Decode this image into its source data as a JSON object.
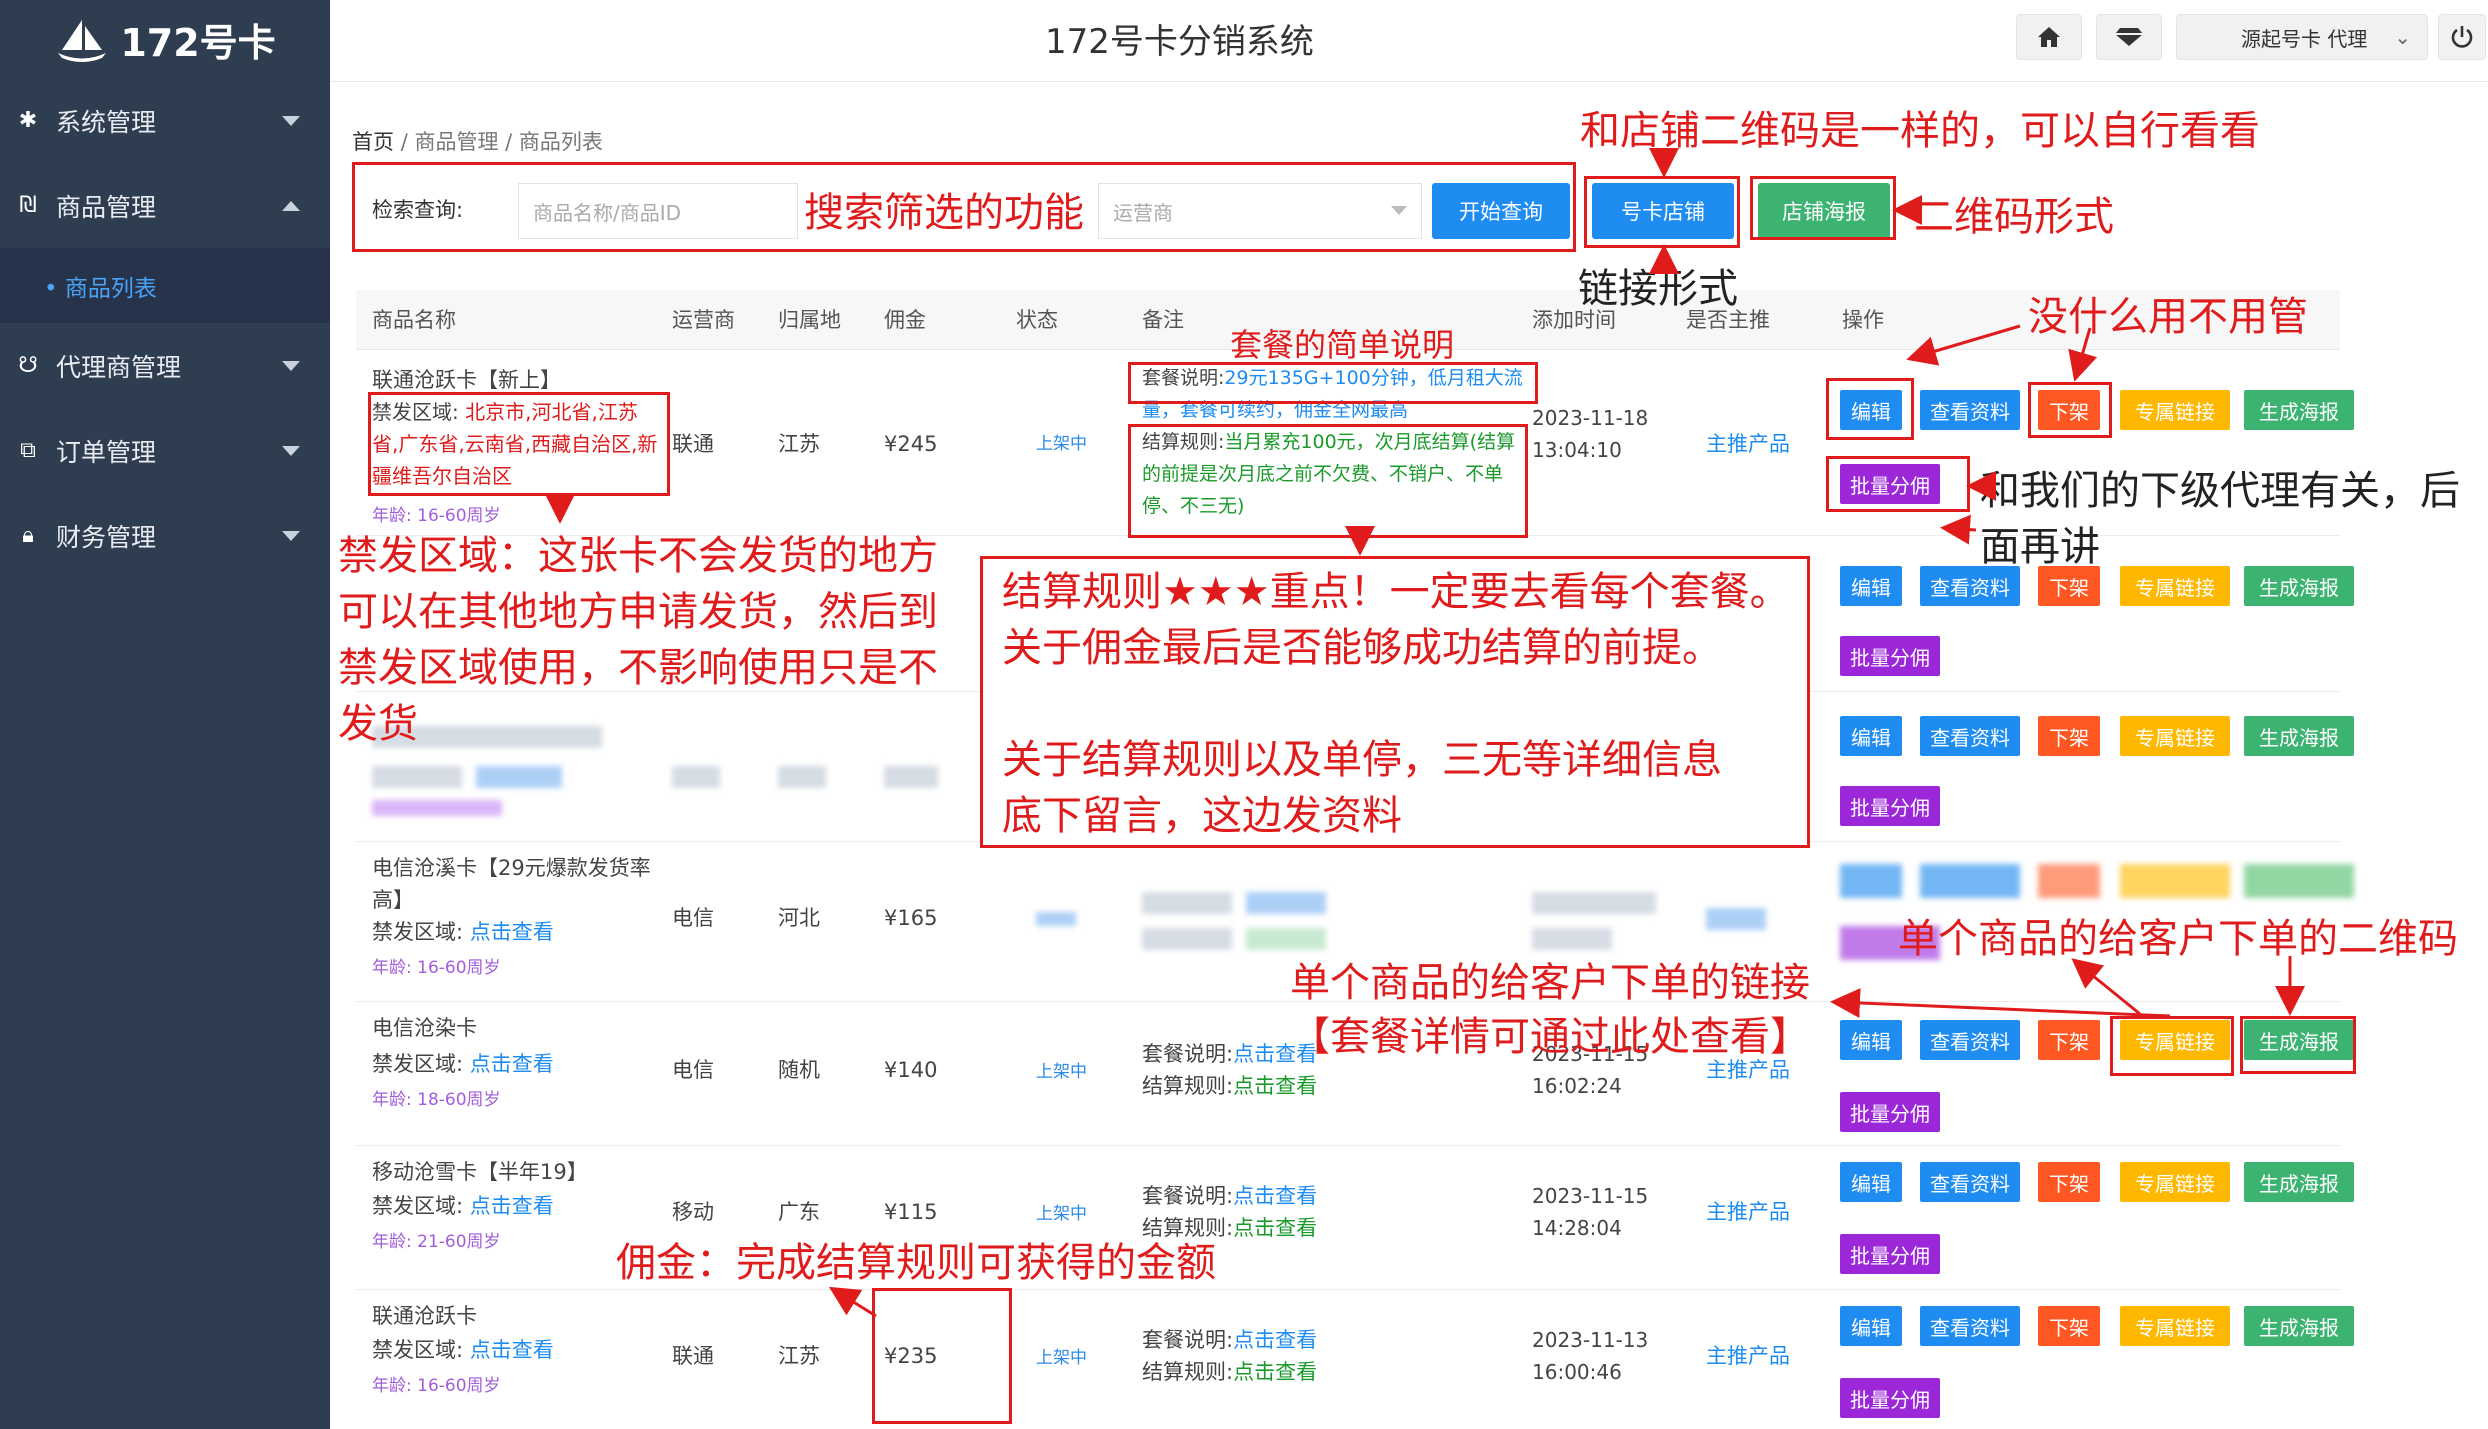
{
  "sidebar": {
    "logo_text": "172号卡",
    "items": [
      {
        "label": "系统管理",
        "icon": "gear-icon"
      },
      {
        "label": "商品管理",
        "icon": "product-icon"
      },
      {
        "label": "代理商管理",
        "icon": "agent-icon"
      },
      {
        "label": "订单管理",
        "icon": "order-icon"
      },
      {
        "label": "财务管理",
        "icon": "finance-icon"
      }
    ],
    "sub_item": "• 商品列表"
  },
  "header": {
    "title": "172号卡分销系统",
    "user_label": "源起号卡 代理",
    "home_icon": "home-icon",
    "theme_icon": "diamond-icon",
    "power_icon": "power-icon"
  },
  "breadcrumb": {
    "home": "首页",
    "sep": "/",
    "level1": "商品管理",
    "level2": "商品列表"
  },
  "search": {
    "label": "检索查询:",
    "name_placeholder": "商品名称/商品ID",
    "operator_placeholder": "运营商",
    "submit_label": "开始查询",
    "shop_label": "号卡店铺",
    "poster_label": "店铺海报"
  },
  "table": {
    "headers": [
      "商品名称",
      "运营商",
      "归属地",
      "佣金",
      "状态",
      "备注",
      "添加时间",
      "是否主推",
      "操作"
    ],
    "actions": {
      "edit": "编辑",
      "view": "查看资料",
      "down": "下架",
      "link": "专属链接",
      "poster": "生成海报",
      "batch": "批量分佣"
    },
    "rows": [
      {
        "name": "联通沧跃卡【新上】",
        "ban_label": "禁发区域:",
        "ban_value": "北京市,河北省,江苏省,广东省,云南省,西藏自治区,新疆维吾尔自治区",
        "age": "年龄: 16-60周岁",
        "operator": "联通",
        "region": "江苏",
        "commission": "¥245",
        "status": "上架中",
        "plan_label": "套餐说明:",
        "plan_value": "29元135G+100分钟，低月租大流量，套餐可续约，佣金全网最高",
        "rule_label": "结算规则:",
        "rule_value": "当月累充100元，次月底结算(结算的前提是次月底之前不欠费、不销户、不单停、不三无)",
        "time": "2023-11-18 13:04:10",
        "main": "主推产品"
      },
      {
        "name": "电信沧溪卡【29元爆款发货率高】",
        "ban_label": "禁发区域:",
        "ban_value": "点击查看",
        "age": "年龄: 16-60周岁",
        "operator": "电信",
        "region": "河北",
        "commission": "¥165"
      },
      {
        "name": "电信沧染卡",
        "ban_label": "禁发区域:",
        "ban_value": "点击查看",
        "age": "年龄: 18-60周岁",
        "operator": "电信",
        "region": "随机",
        "commission": "¥140",
        "status": "上架中",
        "plan_label": "套餐说明:",
        "plan_value": "点击查看",
        "rule_label": "结算规则:",
        "rule_value": "点击查看",
        "time": "2023-11-15 16:02:24",
        "main": "主推产品"
      },
      {
        "name": "移动沧雪卡【半年19】",
        "ban_label": "禁发区域:",
        "ban_value": "点击查看",
        "age": "年龄: 21-60周岁",
        "operator": "移动",
        "region": "广东",
        "commission": "¥115",
        "status": "上架中",
        "plan_label": "套餐说明:",
        "plan_value": "点击查看",
        "rule_label": "结算规则:",
        "rule_value": "点击查看",
        "time": "2023-11-15 14:28:04",
        "main": "主推产品"
      },
      {
        "name": "联通沧跃卡",
        "ban_label": "禁发区域:",
        "ban_value": "点击查看",
        "age": "年龄: 16-60周岁",
        "operator": "联通",
        "region": "江苏",
        "commission": "¥235",
        "status": "上架中",
        "plan_label": "套餐说明:",
        "plan_value": "点击查看",
        "rule_label": "结算规则:",
        "rule_value": "点击查看",
        "time": "2023-11-13 16:00:46",
        "main": "主推产品"
      }
    ]
  },
  "annotations": {
    "shop_qr_same": "和店铺二维码是一样的，可以自行看看",
    "search_function": "搜索筛选的功能",
    "qr_form": "二维码形式",
    "link_form": "链接形式",
    "useless": "没什么用不用管",
    "plan_brief": "套餐的简单说明",
    "sub_agent": "和我们的下级代理有关，后",
    "later": "面再讲",
    "ban_area": "禁发区域：这张卡不会发货的地方\n可以在其他地方申请发货，然后到\n禁发区域使用，不影响使用只是不\n发货",
    "settle_rule": "结算规则★★★重点！一定要去看每个套餐。\n关于佣金最后是否能够成功结算的前提。\n\n关于结算规则以及单停，三无等详细信息\n底下留言，这边发资料",
    "single_qr": "单个商品的给客户下单的二维码",
    "single_link": "单个商品的给客户下单的链接",
    "plan_detail": "【套餐详情可通过此处查看】",
    "commission_note": "佣金：完成结算规则可获得的金额"
  }
}
